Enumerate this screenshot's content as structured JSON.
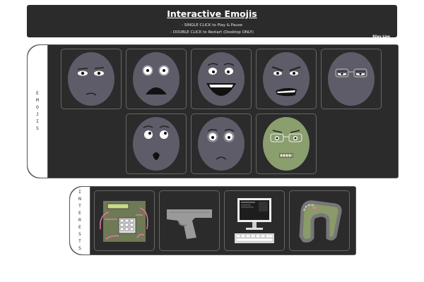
{
  "header": {
    "title": "Interactive Emojis",
    "line1": "- SINGLE CLICK to Play & Pause",
    "line2": "- DOUBLE CLICK to Restart (Desktop ONLY)",
    "author": "Riley Line"
  },
  "emojis": {
    "label": "EMOJIS",
    "items": [
      {
        "name": "skeptical"
      },
      {
        "name": "shocked"
      },
      {
        "name": "laughing"
      },
      {
        "name": "angry"
      },
      {
        "name": "tired"
      },
      {
        "name": "surprised"
      },
      {
        "name": "sad"
      },
      {
        "name": "sick"
      }
    ]
  },
  "interests": {
    "label": "INTERESTS",
    "items": [
      {
        "name": "circuit-board"
      },
      {
        "name": "pistol"
      },
      {
        "name": "computer"
      },
      {
        "name": "race-track"
      }
    ]
  },
  "colors": {
    "panel": "#2b2b2b",
    "face": "#5f5c69",
    "sick_face": "#8a9e6e",
    "accent_pink": "#e27aa0"
  }
}
